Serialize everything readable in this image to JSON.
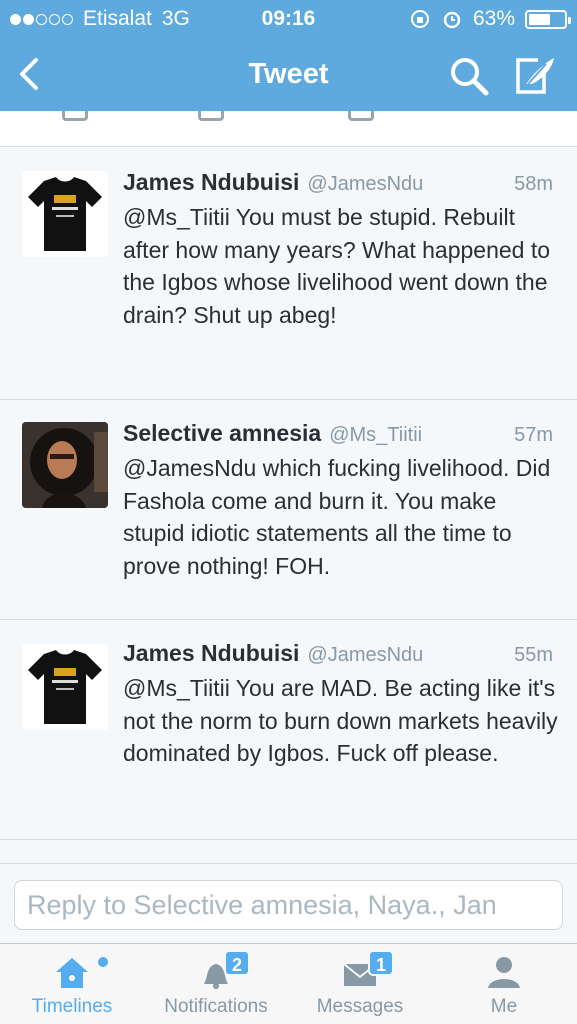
{
  "status_bar": {
    "carrier": "Etisalat",
    "network": "3G",
    "time": "09:16",
    "battery": "63%",
    "battery_level": 0.63
  },
  "nav": {
    "title": "Tweet"
  },
  "tweets": [
    {
      "name": "James Ndubuisi",
      "handle": "@JamesNdu",
      "time": "58m",
      "text": "@Ms_Tiitii You must be stupid. Rebuilt after how many years? What happened to the Igbos whose livelihood went down the drain? Shut up abeg!",
      "avatar": "tshirt-avatar"
    },
    {
      "name": "Selective amnesia",
      "handle": "@Ms_Tiitii",
      "time": "57m",
      "text": "@JamesNdu which fucking livelihood. Did Fashola come and burn it. You make stupid idiotic statements all the time to prove nothing! FOH.",
      "avatar": "photo-avatar"
    },
    {
      "name": "James Ndubuisi",
      "handle": "@JamesNdu",
      "time": "55m",
      "text": "@Ms_Tiitii You are MAD. Be acting like it's not the norm to burn down markets heavily dominated by Igbos. Fuck off please.",
      "avatar": "tshirt-avatar"
    }
  ],
  "reply": {
    "placeholder": "Reply to Selective amnesia, Naya., Jan"
  },
  "tabs": [
    {
      "label": "Timelines",
      "icon": "home-icon",
      "active": true
    },
    {
      "label": "Notifications",
      "icon": "bell-icon",
      "badge": "2"
    },
    {
      "label": "Messages",
      "icon": "envelope-icon",
      "badge": "1"
    },
    {
      "label": "Me",
      "icon": "person-icon"
    }
  ],
  "colors": {
    "header": "#5ea9dd",
    "accent": "#55acee",
    "secondary_text": "#8899a6"
  }
}
